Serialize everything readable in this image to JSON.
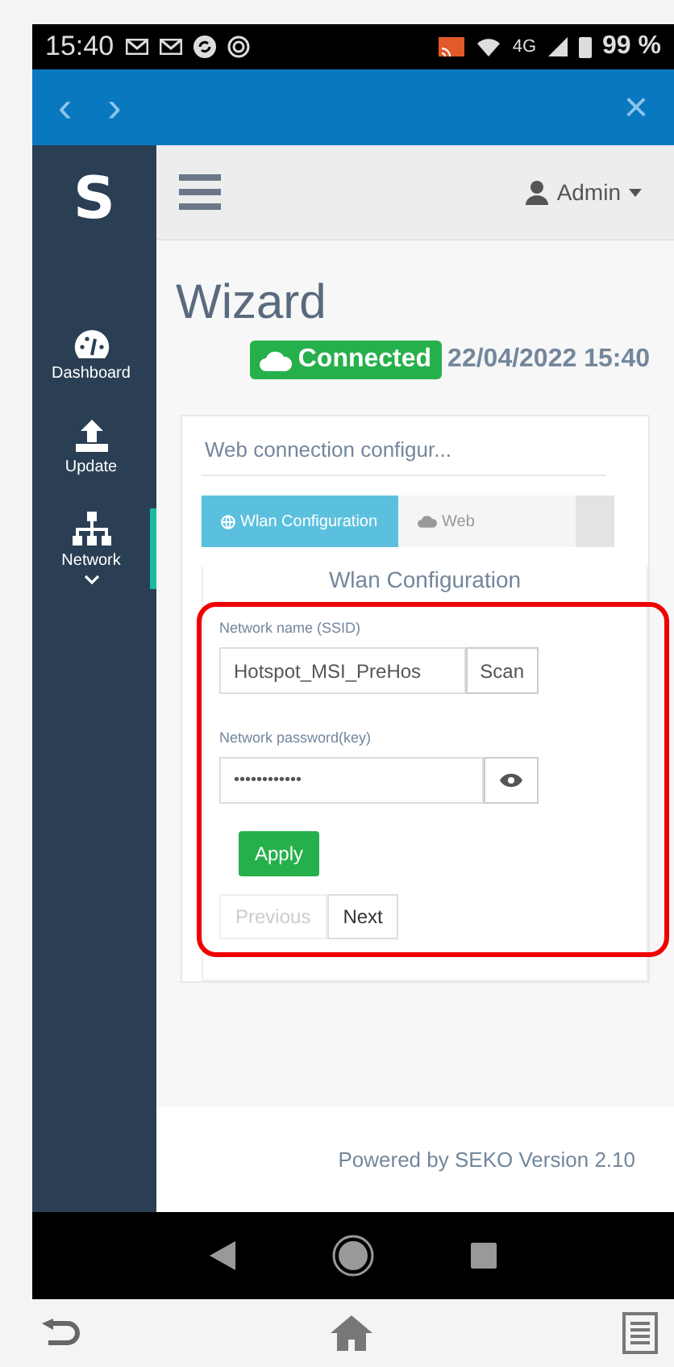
{
  "status_bar": {
    "time": "15:40",
    "network": "4G",
    "battery": "99 %"
  },
  "browser_bar": {
    "back": "‹",
    "forward": "›",
    "close": "×"
  },
  "sidebar": {
    "logo": "S",
    "items": [
      {
        "label": "Dashboard",
        "selected": false,
        "expandable": false
      },
      {
        "label": "Update",
        "selected": false,
        "expandable": false
      },
      {
        "label": "Network",
        "selected": true,
        "expandable": true
      }
    ]
  },
  "header": {
    "user": "Admin"
  },
  "page": {
    "title": "Wizard",
    "status": "Connected",
    "timestamp": "22/04/2022 15:40"
  },
  "card": {
    "title": "Web connection configur...",
    "tabs": [
      {
        "label": "Wlan Configuration",
        "selected": true
      },
      {
        "label": "Web",
        "selected": false
      }
    ],
    "section_title": "Wlan Configuration",
    "ssid": {
      "label": "Network name (SSID)",
      "value": "Hotspot_MSI_PreHos",
      "button": "Scan"
    },
    "password": {
      "label": "Network password(key)",
      "value": "••••••••••••"
    },
    "apply": "Apply",
    "pager": [
      {
        "label": "Previous",
        "disabled": true
      },
      {
        "label": "Next",
        "disabled": false
      }
    ]
  },
  "footer": "Powered by SEKO Version 2.10"
}
